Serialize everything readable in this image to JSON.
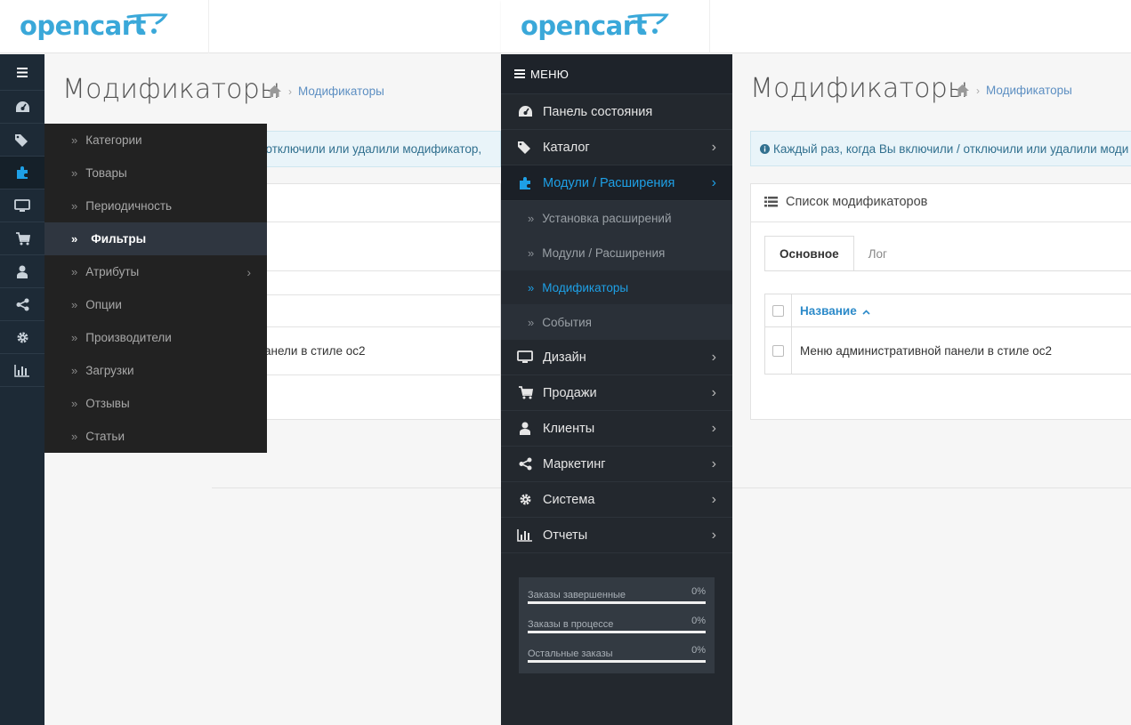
{
  "brand": {
    "logo_text": "opencart",
    "color": "#3aa8d9"
  },
  "left": {
    "page_title": "Модификаторы",
    "breadcrumb": "Модификаторы",
    "alert_text": "/ отключили или удалили модификатор,",
    "table_row_text": "анели в стиле ос2",
    "rail_icons": [
      "dashboard-icon",
      "tags-icon",
      "puzzle-icon",
      "desktop-icon",
      "cart-icon",
      "user-icon",
      "share-icon",
      "gear-icon",
      "bar-chart-icon"
    ],
    "flyout": [
      {
        "label": "Категории"
      },
      {
        "label": "Товары"
      },
      {
        "label": "Периодичность"
      },
      {
        "label": "Фильтры",
        "active": true
      },
      {
        "label": "Атрибуты",
        "has_sub": true
      },
      {
        "label": "Опции"
      },
      {
        "label": "Производители"
      },
      {
        "label": "Загрузки"
      },
      {
        "label": "Отзывы"
      },
      {
        "label": "Статьи"
      }
    ]
  },
  "menu": {
    "header": "МЕНЮ",
    "items": [
      {
        "label": "Панель состояния",
        "icon": "dashboard-icon"
      },
      {
        "label": "Каталог",
        "icon": "tags-icon"
      },
      {
        "label": "Модули / Расширения",
        "icon": "puzzle-icon",
        "active": true
      },
      {
        "label": "Дизайн",
        "icon": "desktop-icon"
      },
      {
        "label": "Продажи",
        "icon": "cart-icon"
      },
      {
        "label": "Клиенты",
        "icon": "user-icon"
      },
      {
        "label": "Маркетинг",
        "icon": "share-icon"
      },
      {
        "label": "Система",
        "icon": "gear-icon"
      },
      {
        "label": "Отчеты",
        "icon": "bar-chart-icon"
      }
    ],
    "submenu": [
      {
        "label": "Установка расширений"
      },
      {
        "label": "Модули / Расширения"
      },
      {
        "label": "Модификаторы",
        "active": true
      },
      {
        "label": "События"
      }
    ],
    "stats": [
      {
        "label": "Заказы завершенные",
        "value": "0%",
        "fraction": 0
      },
      {
        "label": "Заказы в процессе",
        "value": "0%",
        "fraction": 0
      },
      {
        "label": "Остальные заказы",
        "value": "0%",
        "fraction": 0
      }
    ]
  },
  "right": {
    "page_title": "Модификаторы",
    "breadcrumb": "Модификаторы",
    "alert_text": "Каждый раз, когда Вы включили / отключили или удалили моди",
    "panel_title": "Список модификаторов",
    "tabs": [
      "Основное",
      "Лог"
    ],
    "column_name": "Название",
    "row_name": "Меню административной панели в стиле ос2"
  },
  "colors": {
    "accent": "#1ea0e6",
    "sidebar": "#23282e",
    "rail": "#1d2a36",
    "flyout": "#222222"
  }
}
